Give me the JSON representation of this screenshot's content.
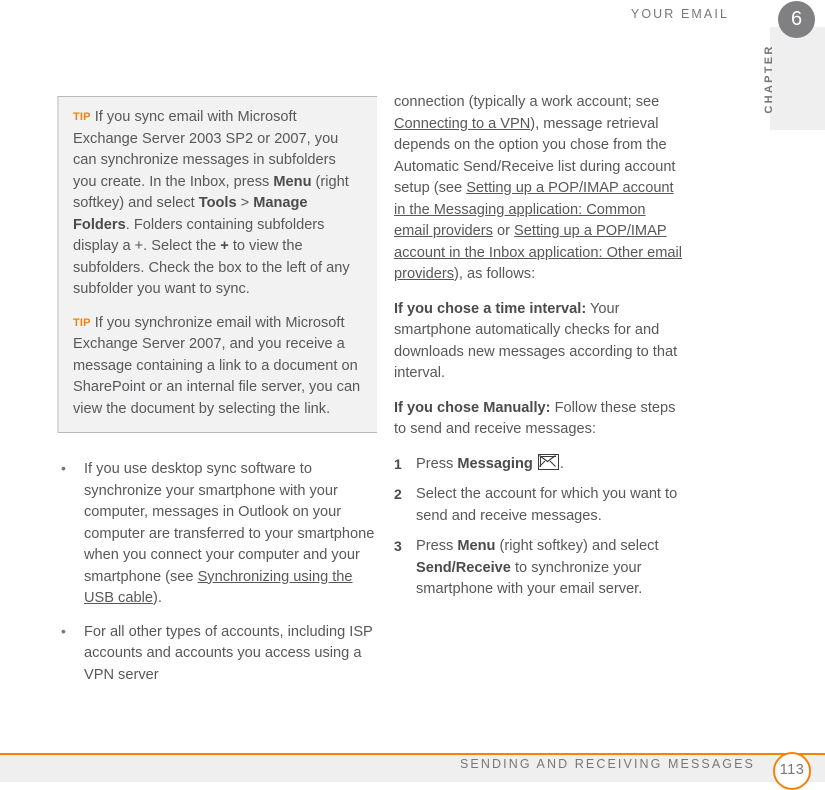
{
  "header": {
    "running_head": "YOUR EMAIL",
    "chapter_word": "CHAPTER",
    "chapter_number": "6"
  },
  "colors": {
    "accent_orange": "#f5820b",
    "chapter_gray": "#808082",
    "band_gray": "#efefef",
    "tip_bg": "#f2f2f2",
    "text_gray": "#58585a"
  },
  "left_column": {
    "tips": [
      {
        "label": "TIP",
        "segments": [
          {
            "text": "If you sync email with Microsoft Exchange Server 2003 SP2 or 2007, you can synchronize messages in subfolders you create. In the Inbox, press ",
            "bold": false
          },
          {
            "text": "Menu",
            "bold": true
          },
          {
            "text": " (right softkey) and select ",
            "bold": false
          },
          {
            "text": "Tools",
            "bold": true
          },
          {
            "text": " > ",
            "bold": false
          },
          {
            "text": "Manage Folders",
            "bold": true
          },
          {
            "text": ". Folders containing subfolders display a +. Select the ",
            "bold": false
          },
          {
            "text": "+",
            "bold": true
          },
          {
            "text": " to view the subfolders. Check the box to the left of any subfolder you want to sync.",
            "bold": false
          }
        ]
      },
      {
        "label": "TIP",
        "segments": [
          {
            "text": "If you synchronize email with Microsoft Exchange Server 2007, and you receive a message containing a link to a document on SharePoint or an internal file server, you can view the document by selecting the link.",
            "bold": false
          }
        ]
      }
    ],
    "bullets": [
      {
        "segments": [
          {
            "text": "If you use desktop sync software to synchronize your smartphone with your computer, messages in Outlook on your computer are transferred to your smartphone when you connect your computer and your smartphone (see ",
            "style": "normal"
          },
          {
            "text": "Synchronizing using the USB cable",
            "style": "xref"
          },
          {
            "text": ").",
            "style": "normal"
          }
        ]
      },
      {
        "segments": [
          {
            "text": "For all other types of accounts, including ISP accounts and accounts you access using a VPN server",
            "style": "normal"
          }
        ]
      }
    ]
  },
  "right_column": {
    "intro": {
      "segments": [
        {
          "text": "connection (typically a work account; see ",
          "style": "normal"
        },
        {
          "text": "Connecting to a VPN",
          "style": "xref"
        },
        {
          "text": "), message retrieval depends on the option you chose from the Automatic Send/Receive list during account setup (see ",
          "style": "normal"
        },
        {
          "text": "Setting up a POP/IMAP account in the Messaging application: Common email providers",
          "style": "xref"
        },
        {
          "text": " or ",
          "style": "normal"
        },
        {
          "text": "Setting up a POP/IMAP account in the Inbox application: Other email providers",
          "style": "xref"
        },
        {
          "text": "), as follows:",
          "style": "normal"
        }
      ]
    },
    "paragraphs": [
      {
        "segments": [
          {
            "text": "If you chose a time interval:",
            "style": "bold"
          },
          {
            "text": " Your smartphone automatically checks for and downloads new messages according to that interval.",
            "style": "normal"
          }
        ]
      },
      {
        "segments": [
          {
            "text": "If you chose Manually:",
            "style": "bold"
          },
          {
            "text": " Follow these steps to send and receive messages:",
            "style": "normal"
          }
        ]
      }
    ],
    "steps": [
      {
        "number": "1",
        "segments": [
          {
            "text": "Press ",
            "style": "normal"
          },
          {
            "text": "Messaging",
            "style": "bold"
          },
          {
            "text": " ",
            "style": "normal"
          },
          {
            "text": "envelope-icon",
            "style": "icon"
          },
          {
            "text": ".",
            "style": "normal"
          }
        ]
      },
      {
        "number": "2",
        "segments": [
          {
            "text": "Select the account for which you want to send and receive messages.",
            "style": "normal"
          }
        ]
      },
      {
        "number": "3",
        "segments": [
          {
            "text": "Press ",
            "style": "normal"
          },
          {
            "text": "Menu",
            "style": "bold"
          },
          {
            "text": " (right softkey) and select ",
            "style": "normal"
          },
          {
            "text": "Send/Receive",
            "style": "bold"
          },
          {
            "text": " to synchronize your smartphone with your email server.",
            "style": "normal"
          }
        ]
      }
    ]
  },
  "footer": {
    "text": "SENDING AND RECEIVING MESSAGES",
    "page_number": "113"
  }
}
